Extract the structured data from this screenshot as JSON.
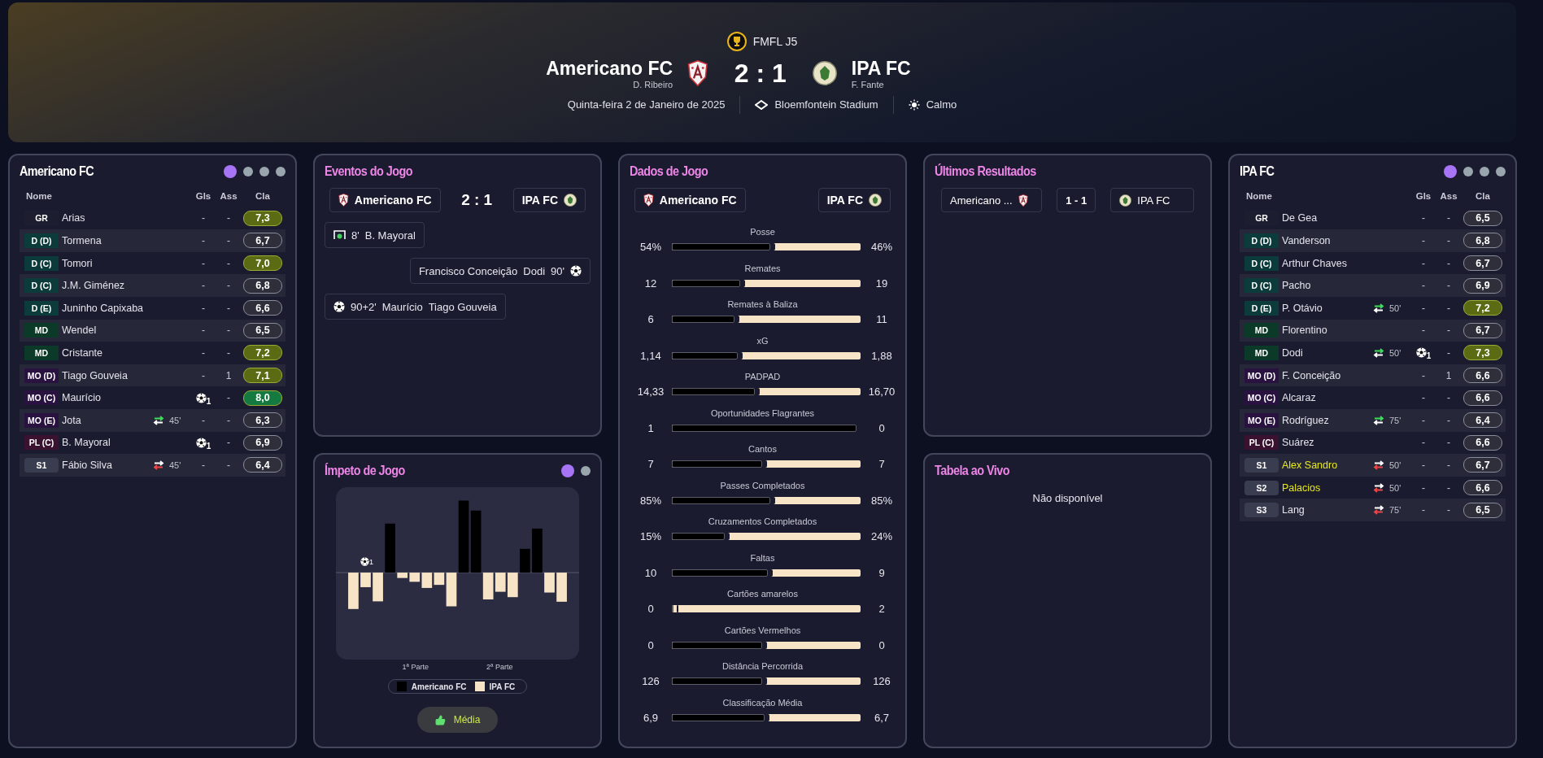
{
  "header": {
    "competition": "FMFL J5",
    "home": {
      "name": "Americano FC",
      "manager": "D. Ribeiro"
    },
    "score": "2 : 1",
    "away": {
      "name": "IPA FC",
      "manager": "F. Fante"
    },
    "date": "Quinta-feira 2 de Janeiro de 2025",
    "stadium": "Bloemfontein Stadium",
    "weather": "Calmo"
  },
  "home_lineup": {
    "title": "Americano FC",
    "tabs": [
      {
        "selected": true
      },
      {
        "selected": false
      },
      {
        "selected": false
      },
      {
        "selected": false
      }
    ],
    "columns": [
      "Nome",
      "Gls",
      "Ass",
      "Cla"
    ],
    "players": [
      {
        "position": {
          "label": "GR",
          "color": "#1c1d2e"
        },
        "name": "Arias",
        "highlighted": false,
        "goals": {
          "kind": "none",
          "text": "-"
        },
        "assists": "-",
        "rating": {
          "value": "7,3",
          "color": "#5b6b14"
        }
      },
      {
        "position": {
          "label": "D (D)",
          "color": "#0c3b3b"
        },
        "name": "Tormena",
        "highlighted": false,
        "goals": {
          "kind": "none",
          "text": "-"
        },
        "assists": "-",
        "rating": {
          "value": "6,7",
          "color": "#2e2f3a"
        }
      },
      {
        "position": {
          "label": "D (C)",
          "color": "#0c3b3b"
        },
        "name": "Tomori",
        "highlighted": false,
        "goals": {
          "kind": "none",
          "text": "-"
        },
        "assists": "-",
        "rating": {
          "value": "7,0",
          "color": "#5b6b14"
        }
      },
      {
        "position": {
          "label": "D (C)",
          "color": "#0c3b3b"
        },
        "name": "J.M. Giménez",
        "highlighted": false,
        "goals": {
          "kind": "none",
          "text": "-"
        },
        "assists": "-",
        "rating": {
          "value": "6,8",
          "color": "#2e2f3a"
        }
      },
      {
        "position": {
          "label": "D (E)",
          "color": "#0c3b3b"
        },
        "name": "Juninho Capixaba",
        "highlighted": false,
        "goals": {
          "kind": "none",
          "text": "-"
        },
        "assists": "-",
        "rating": {
          "value": "6,6",
          "color": "#2e2f3a"
        }
      },
      {
        "position": {
          "label": "MD",
          "color": "#0c3a28"
        },
        "name": "Wendel",
        "highlighted": false,
        "goals": {
          "kind": "none",
          "text": "-"
        },
        "assists": "-",
        "rating": {
          "value": "6,5",
          "color": "#2e2f3a"
        }
      },
      {
        "position": {
          "label": "MD",
          "color": "#0c3a28"
        },
        "name": "Cristante",
        "highlighted": false,
        "goals": {
          "kind": "none",
          "text": "-"
        },
        "assists": "-",
        "rating": {
          "value": "7,2",
          "color": "#5b6b14"
        }
      },
      {
        "position": {
          "label": "MO (D)",
          "color": "#2a1240"
        },
        "name": "Tiago Gouveia",
        "highlighted": false,
        "goals": {
          "kind": "none",
          "text": "-"
        },
        "assists": "1",
        "rating": {
          "value": "7,1",
          "color": "#5b6b14"
        }
      },
      {
        "position": {
          "label": "MO (C)",
          "color": "#2a1240"
        },
        "name": "Maurício",
        "highlighted": false,
        "goals": {
          "kind": "scored",
          "text": "1"
        },
        "assists": "-",
        "rating": {
          "value": "8,0",
          "color": "#157a40"
        }
      },
      {
        "position": {
          "label": "MO (E)",
          "color": "#2a1240"
        },
        "name": "Jota",
        "highlighted": false,
        "sub": {
          "kind": "off",
          "minute": "45'"
        },
        "goals": {
          "kind": "none",
          "text": "-"
        },
        "assists": "-",
        "rating": {
          "value": "6,3",
          "color": "#2e2f3a"
        }
      },
      {
        "position": {
          "label": "PL (C)",
          "color": "#3a1230"
        },
        "name": "B. Mayoral",
        "highlighted": false,
        "goals": {
          "kind": "scored",
          "text": "1"
        },
        "assists": "-",
        "rating": {
          "value": "6,9",
          "color": "#2e2f3a"
        }
      },
      {
        "position": {
          "label": "S1",
          "color": "#3a3c4f"
        },
        "name": "Fábio Silva",
        "highlighted": false,
        "sub": {
          "kind": "on",
          "minute": "45'"
        },
        "goals": {
          "kind": "none",
          "text": "-"
        },
        "assists": "-",
        "rating": {
          "value": "6,4",
          "color": "#2e2f3a"
        }
      }
    ]
  },
  "events": {
    "title": "Eventos do Jogo",
    "home": "Americano FC",
    "score": "2 : 1",
    "away": "IPA FC",
    "items": [
      {
        "kind": "home_net",
        "minute": "8'",
        "player": "B. Mayoral"
      },
      {
        "kind": "away_ball",
        "minute": "90'",
        "player": "Dodi",
        "assist": "Francisco Conceição"
      },
      {
        "kind": "home_ball",
        "minute": "90+2'",
        "player": "Maurício",
        "assist": "Tiago Gouveia"
      }
    ]
  },
  "momentum": {
    "title": "Ímpeto de Jogo",
    "tabs": [
      {
        "selected": true
      },
      {
        "selected": false
      }
    ],
    "goal_marker": "1",
    "axis_labels": [
      "1ª Parte",
      "2ª Parte"
    ],
    "legend": [
      "Americano FC",
      "IPA FC"
    ],
    "button": "Média"
  },
  "stats": {
    "title": "Dados de Jogo",
    "home": "Americano FC",
    "away": "IPA FC",
    "rows": [
      {
        "label": "Posse",
        "home": "54%",
        "away": "46%",
        "level": 0.52
      },
      {
        "label": "Remates",
        "home": "12",
        "away": "19",
        "level": 0.36
      },
      {
        "label": "Remates à Baliza",
        "home": "6",
        "away": "11",
        "level": 0.33
      },
      {
        "label": "xG",
        "home": "1,14",
        "away": "1,88",
        "level": 0.35
      },
      {
        "label": "PADPAD",
        "home": "14,33",
        "away": "16,70",
        "level": 0.44
      },
      {
        "label": "Oportunidades Flagrantes",
        "home": "1",
        "away": "0",
        "level": 0.98
      },
      {
        "label": "Cantos",
        "home": "7",
        "away": "7",
        "level": 0.48
      },
      {
        "label": "Passes Completados",
        "home": "85%",
        "away": "85%",
        "level": 0.52
      },
      {
        "label": "Cruzamentos Completados",
        "home": "15%",
        "away": "24%",
        "level": 0.28
      },
      {
        "label": "Faltas",
        "home": "10",
        "away": "9",
        "level": 0.51
      },
      {
        "label": "Cartões amarelos",
        "home": "0",
        "away": "2",
        "level": 0.01
      },
      {
        "label": "Cartões Vermelhos",
        "home": "0",
        "away": "0",
        "level": 0.48
      },
      {
        "label": "Distância Percorrida",
        "home": "126",
        "away": "126",
        "level": 0.48
      },
      {
        "label": "Classificação Média",
        "home": "6,9",
        "away": "6,7",
        "level": 0.49
      }
    ]
  },
  "recent": {
    "title": "Últimos Resultados",
    "results": [
      {
        "home": "Americano ...",
        "score": "1 - 1",
        "away": "IPA FC"
      }
    ]
  },
  "live_table": {
    "title": "Tabela ao Vivo",
    "message": "Não disponível"
  },
  "away_lineup": {
    "title": "IPA FC",
    "tabs": [
      {
        "selected": true
      },
      {
        "selected": false
      },
      {
        "selected": false
      },
      {
        "selected": false
      }
    ],
    "columns": [
      "Nome",
      "Gls",
      "Ass",
      "Cla"
    ],
    "players": [
      {
        "position": {
          "label": "GR",
          "color": "#1c1d2e"
        },
        "name": "De Gea",
        "highlighted": false,
        "goals": {
          "kind": "none",
          "text": "-"
        },
        "assists": "-",
        "rating": {
          "value": "6,5",
          "color": "#2e2f3a"
        }
      },
      {
        "position": {
          "label": "D (D)",
          "color": "#0c3b3b"
        },
        "name": "Vanderson",
        "highlighted": false,
        "goals": {
          "kind": "none",
          "text": "-"
        },
        "assists": "-",
        "rating": {
          "value": "6,8",
          "color": "#2e2f3a"
        }
      },
      {
        "position": {
          "label": "D (C)",
          "color": "#0c3b3b"
        },
        "name": "Arthur Chaves",
        "highlighted": false,
        "goals": {
          "kind": "none",
          "text": "-"
        },
        "assists": "-",
        "rating": {
          "value": "6,7",
          "color": "#2e2f3a"
        }
      },
      {
        "position": {
          "label": "D (C)",
          "color": "#0c3b3b"
        },
        "name": "Pacho",
        "highlighted": false,
        "goals": {
          "kind": "none",
          "text": "-"
        },
        "assists": "-",
        "rating": {
          "value": "6,9",
          "color": "#2e2f3a"
        }
      },
      {
        "position": {
          "label": "D (E)",
          "color": "#0c3b3b"
        },
        "name": "P. Otávio",
        "highlighted": false,
        "sub": {
          "kind": "off",
          "minute": "50'"
        },
        "goals": {
          "kind": "none",
          "text": "-"
        },
        "assists": "-",
        "rating": {
          "value": "7,2",
          "color": "#5b6b14"
        }
      },
      {
        "position": {
          "label": "MD",
          "color": "#0c3a28"
        },
        "name": "Florentino",
        "highlighted": false,
        "goals": {
          "kind": "none",
          "text": "-"
        },
        "assists": "-",
        "rating": {
          "value": "6,7",
          "color": "#2e2f3a"
        }
      },
      {
        "position": {
          "label": "MD",
          "color": "#0c3a28"
        },
        "name": "Dodi",
        "highlighted": false,
        "sub": {
          "kind": "off",
          "minute": "50'"
        },
        "goals": {
          "kind": "scored",
          "text": "1"
        },
        "assists": "-",
        "rating": {
          "value": "7,3",
          "color": "#5b6b14"
        }
      },
      {
        "position": {
          "label": "MO (D)",
          "color": "#2a1240"
        },
        "name": "F. Conceição",
        "highlighted": false,
        "goals": {
          "kind": "none",
          "text": "-"
        },
        "assists": "1",
        "rating": {
          "value": "6,6",
          "color": "#2e2f3a"
        }
      },
      {
        "position": {
          "label": "MO (C)",
          "color": "#2a1240"
        },
        "name": "Alcaraz",
        "highlighted": false,
        "goals": {
          "kind": "none",
          "text": "-"
        },
        "assists": "-",
        "rating": {
          "value": "6,6",
          "color": "#2e2f3a"
        }
      },
      {
        "position": {
          "label": "MO (E)",
          "color": "#2a1240"
        },
        "name": "Rodríguez",
        "highlighted": false,
        "sub": {
          "kind": "off",
          "minute": "75'"
        },
        "goals": {
          "kind": "none",
          "text": "-"
        },
        "assists": "-",
        "rating": {
          "value": "6,4",
          "color": "#2e2f3a"
        }
      },
      {
        "position": {
          "label": "PL (C)",
          "color": "#3a1230"
        },
        "name": "Suárez",
        "highlighted": false,
        "goals": {
          "kind": "none",
          "text": "-"
        },
        "assists": "-",
        "rating": {
          "value": "6,6",
          "color": "#2e2f3a"
        }
      },
      {
        "position": {
          "label": "S1",
          "color": "#3a3c4f"
        },
        "name": "Alex Sandro",
        "highlighted": true,
        "sub": {
          "kind": "on",
          "minute": "50'"
        },
        "goals": {
          "kind": "none",
          "text": "-"
        },
        "assists": "-",
        "rating": {
          "value": "6,7",
          "color": "#2e2f3a"
        }
      },
      {
        "position": {
          "label": "S2",
          "color": "#3a3c4f"
        },
        "name": "Palacios",
        "highlighted": true,
        "sub": {
          "kind": "on",
          "minute": "50'"
        },
        "goals": {
          "kind": "none",
          "text": "-"
        },
        "assists": "-",
        "rating": {
          "value": "6,6",
          "color": "#2e2f3a"
        }
      },
      {
        "position": {
          "label": "S3",
          "color": "#3a3c4f"
        },
        "name": "Lang",
        "highlighted": false,
        "sub": {
          "kind": "on",
          "minute": "75'"
        },
        "goals": {
          "kind": "none",
          "text": "-"
        },
        "assists": "-",
        "rating": {
          "value": "6,5",
          "color": "#2e2f3a"
        }
      }
    ]
  }
}
